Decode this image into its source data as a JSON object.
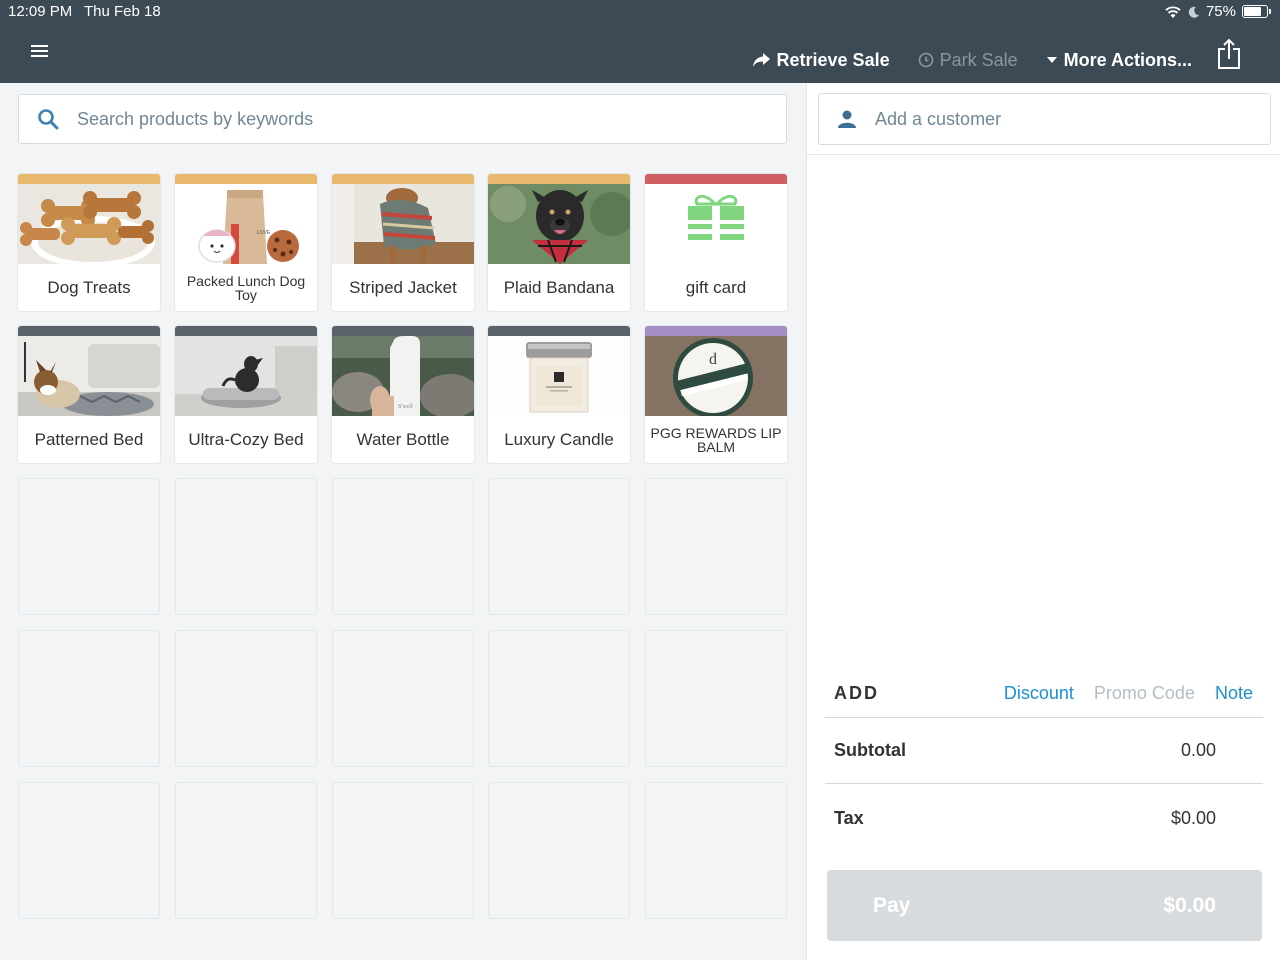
{
  "status": {
    "time": "12:09 PM",
    "date": "Thu Feb 18",
    "battery": "75%",
    "battery_level": 0.75
  },
  "header": {
    "retrieve_sale": "Retrieve Sale",
    "park_sale": "Park Sale",
    "more_actions": "More Actions..."
  },
  "search": {
    "placeholder": "Search products by keywords"
  },
  "products": [
    {
      "label": "Dog Treats",
      "color": "#e8b86d"
    },
    {
      "label": "Packed Lunch Dog Toy",
      "color": "#e8b86d"
    },
    {
      "label": "Striped Jacket",
      "color": "#e8b86d"
    },
    {
      "label": "Plaid Bandana",
      "color": "#e8b86d"
    },
    {
      "label": "gift card",
      "color": "#cf5f63"
    },
    {
      "label": "Patterned Bed",
      "color": "#5a6168"
    },
    {
      "label": "Ultra-Cozy Bed",
      "color": "#5a6168"
    },
    {
      "label": "Water Bottle",
      "color": "#5a6168"
    },
    {
      "label": "Luxury Candle",
      "color": "#5a6168"
    },
    {
      "label": "PGG REWARDS LIP BALM",
      "color": "#a58cc2"
    }
  ],
  "customer": {
    "placeholder": "Add a customer"
  },
  "cart": {
    "add_label": "ADD",
    "discount": "Discount",
    "promo_code": "Promo Code",
    "note": "Note",
    "subtotal_label": "Subtotal",
    "subtotal_value": "0.00",
    "tax_label": "Tax",
    "tax_value": "$0.00",
    "pay_label": "Pay",
    "pay_value": "$0.00"
  }
}
